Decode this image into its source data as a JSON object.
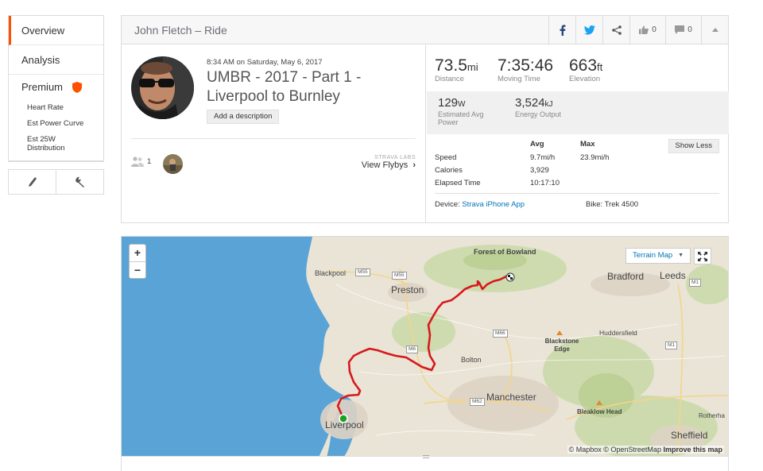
{
  "sidebar": {
    "overview": "Overview",
    "analysis": "Analysis",
    "premium": "Premium",
    "sub_items": [
      "Heart Rate",
      "Est Power Curve",
      "Est 25W Distribution"
    ]
  },
  "header": {
    "title": "John Fletch – Ride",
    "kudos_count": "0",
    "comment_count": "0"
  },
  "activity": {
    "date": "8:34 AM on Saturday, May 6, 2017",
    "name": "UMBR - 2017 - Part 1 - Liverpool to Burnley",
    "add_description": "Add a description",
    "group_count": "1",
    "labs": "STRAVA LABS",
    "flybys": "View Flybys"
  },
  "stats": {
    "distance": {
      "value": "73.5",
      "unit": "mi",
      "label": "Distance"
    },
    "moving_time": {
      "value": "7:35:46",
      "label": "Moving Time"
    },
    "elevation": {
      "value": "663",
      "unit": "ft",
      "label": "Elevation"
    },
    "power": {
      "value": "129",
      "unit": "W",
      "label": "Estimated Avg Power"
    },
    "energy": {
      "value": "3,524",
      "unit": "kJ",
      "label": "Energy Output"
    },
    "table": {
      "col_avg": "Avg",
      "col_max": "Max",
      "rows": [
        {
          "label": "Speed",
          "avg": "9.7mi/h",
          "max": "23.9mi/h"
        },
        {
          "label": "Calories",
          "avg": "3,929",
          "max": ""
        },
        {
          "label": "Elapsed Time",
          "avg": "10:17:10",
          "max": ""
        }
      ]
    },
    "show_less": "Show Less",
    "device_label": "Device:",
    "device": "Strava iPhone App",
    "bike": "Bike: Trek 4500"
  },
  "map": {
    "zoom_in": "+",
    "zoom_out": "−",
    "style_select": "Terrain Map",
    "attribution_a": "© Mapbox © OpenStreetMap",
    "attribution_b": "Improve this map",
    "places": {
      "forest": "Forest of Bowland",
      "blackpool": "Blackpool",
      "preston": "Preston",
      "bradford": "Bradford",
      "leeds": "Leeds",
      "huddersfield": "Huddersfield",
      "blackstone": "Blackstone Edge",
      "bolton": "Bolton",
      "manchester": "Manchester",
      "bleaklow": "Bleaklow Head",
      "liverpool": "Liverpool",
      "sheffield": "Sheffield",
      "rotherham": "Rotherha"
    },
    "roads": {
      "m55a": "M55",
      "m55b": "M55",
      "m6": "M6",
      "m66": "M66",
      "m62": "M62",
      "m1a": "M1",
      "m1b": "M1"
    },
    "colors": {
      "sea": "#5aa3d6",
      "land": "#e9e4d6",
      "route": "#d7191c",
      "start": "#1ea01e"
    }
  }
}
